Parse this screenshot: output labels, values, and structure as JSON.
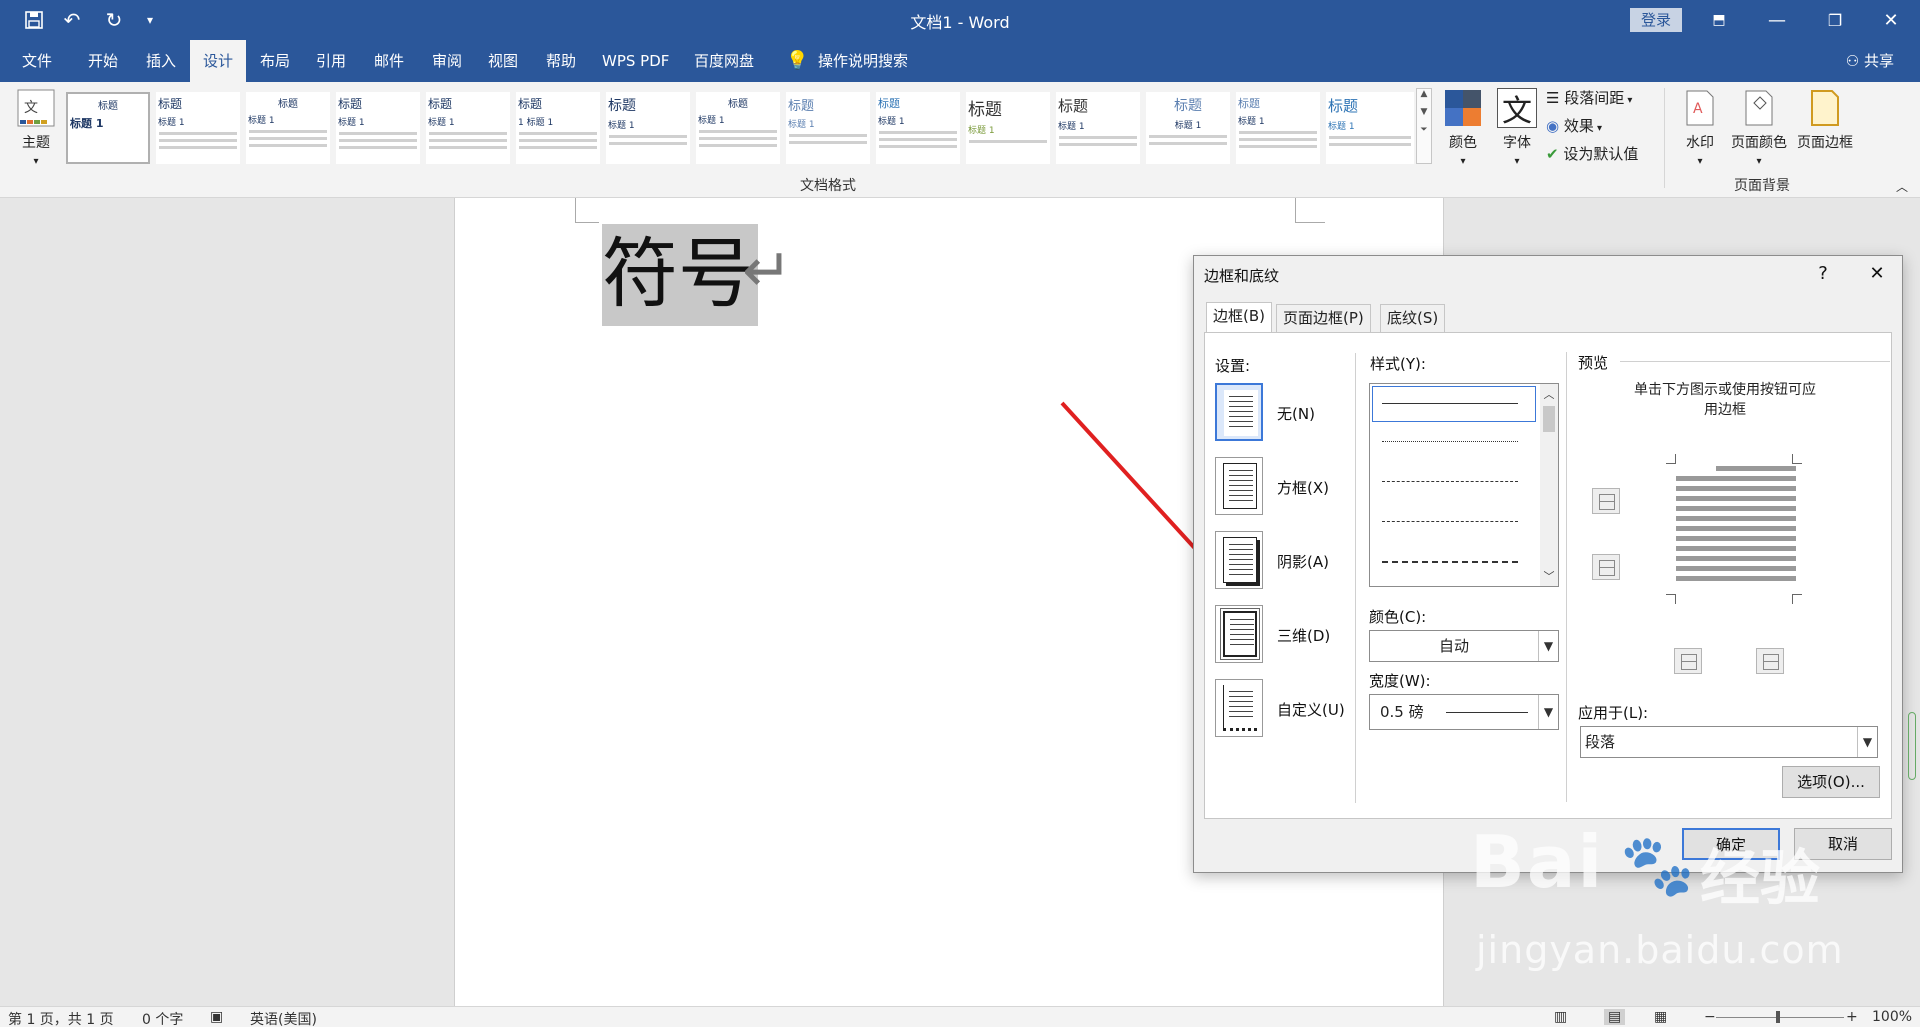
{
  "window": {
    "title": "文档1  -  Word",
    "login_label": "登录"
  },
  "menu": {
    "tabs": [
      "文件",
      "开始",
      "插入",
      "设计",
      "布局",
      "引用",
      "邮件",
      "审阅",
      "视图",
      "帮助",
      "WPS PDF",
      "百度网盘"
    ],
    "active_tab": "设计",
    "tell_me": "操作说明搜索",
    "share": "共享"
  },
  "ribbon": {
    "theme_label": "主题",
    "gallery_items": [
      {
        "title": "标题",
        "sub": "标题 1"
      },
      {
        "title": "标题",
        "sub": "标题 1"
      },
      {
        "title": "标题",
        "sub": "标题 1"
      },
      {
        "title": "标题",
        "sub": "标题 1"
      },
      {
        "title": "标题",
        "sub": "标题 1"
      },
      {
        "title": "标题",
        "sub": "1 标题 1"
      },
      {
        "title": "标题",
        "sub": "标题 1"
      },
      {
        "title": "标题",
        "sub": "标题 1"
      },
      {
        "title": "标题",
        "sub": "标题 1"
      },
      {
        "title": "标题",
        "sub": "标题 1"
      },
      {
        "title": "标题",
        "sub": "标题 1"
      },
      {
        "title": "标题",
        "sub": "标题 1"
      },
      {
        "title": "标题",
        "sub": "标题 1"
      },
      {
        "title": "标题",
        "sub": "标题 1"
      },
      {
        "title": "标题",
        "sub": "标题 1"
      }
    ],
    "group_doc_format": "文档格式",
    "colors_label": "颜色",
    "fonts_label": "字体",
    "fonts_glyph": "文",
    "paragraph_spacing": "段落间距",
    "effects": "效果",
    "set_default": "设为默认值",
    "watermark": "水印",
    "page_color": "页面颜色",
    "page_borders": "页面边框",
    "group_page_background": "页面背景"
  },
  "document": {
    "selected_text": "符号"
  },
  "dialog": {
    "title": "边框和底纹",
    "help": "?",
    "close": "✕",
    "tabs": [
      "边框(B)",
      "页面边框(P)",
      "底纹(S)"
    ],
    "settings_label": "设置:",
    "settings": [
      "无(N)",
      "方框(X)",
      "阴影(A)",
      "三维(D)",
      "自定义(U)"
    ],
    "style_label": "样式(Y):",
    "color_label": "颜色(C):",
    "color_value": "自动",
    "width_label": "宽度(W):",
    "width_value": "0.5 磅",
    "preview_label": "预览",
    "preview_hint_1": "单击下方图示或使用按钮可应",
    "preview_hint_2": "用边框",
    "apply_to_label": "应用于(L):",
    "apply_to_value": "段落",
    "options_button": "选项(O)...",
    "ok_button": "确定",
    "cancel_button": "取消"
  },
  "status": {
    "page": "第 1 页，共 1 页",
    "words": "0 个字",
    "language": "英语(美国)",
    "zoom": "100%"
  },
  "watermark": {
    "brand": "Bai",
    "brand_cn": "经验",
    "url": "jingyan.baidu.com"
  },
  "colors": {
    "accent": "#2b579a",
    "arrow": "#e02020"
  }
}
